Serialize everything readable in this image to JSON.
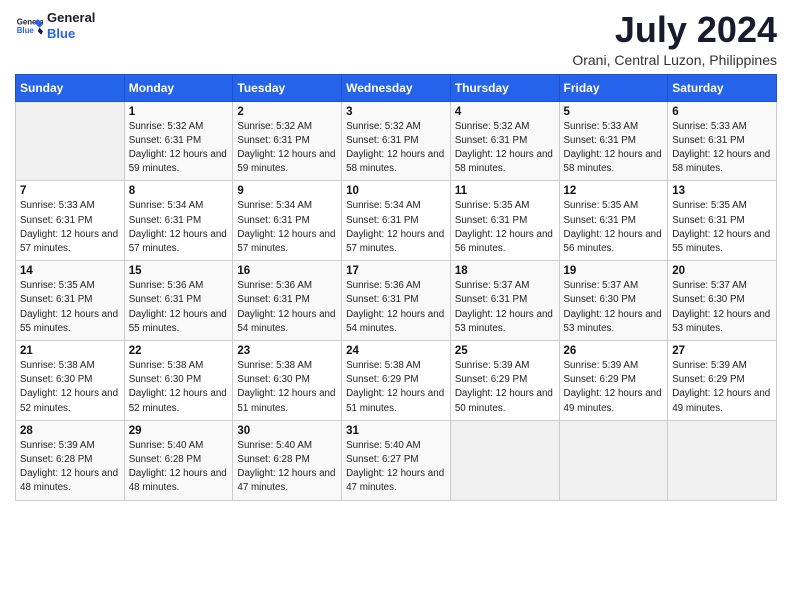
{
  "header": {
    "logo_line1": "General",
    "logo_line2": "Blue",
    "month": "July 2024",
    "location": "Orani, Central Luzon, Philippines"
  },
  "days_of_week": [
    "Sunday",
    "Monday",
    "Tuesday",
    "Wednesday",
    "Thursday",
    "Friday",
    "Saturday"
  ],
  "weeks": [
    [
      {
        "num": "",
        "empty": true
      },
      {
        "num": "1",
        "sunrise": "5:32 AM",
        "sunset": "6:31 PM",
        "daylight": "12 hours and 59 minutes."
      },
      {
        "num": "2",
        "sunrise": "5:32 AM",
        "sunset": "6:31 PM",
        "daylight": "12 hours and 59 minutes."
      },
      {
        "num": "3",
        "sunrise": "5:32 AM",
        "sunset": "6:31 PM",
        "daylight": "12 hours and 58 minutes."
      },
      {
        "num": "4",
        "sunrise": "5:32 AM",
        "sunset": "6:31 PM",
        "daylight": "12 hours and 58 minutes."
      },
      {
        "num": "5",
        "sunrise": "5:33 AM",
        "sunset": "6:31 PM",
        "daylight": "12 hours and 58 minutes."
      },
      {
        "num": "6",
        "sunrise": "5:33 AM",
        "sunset": "6:31 PM",
        "daylight": "12 hours and 58 minutes."
      }
    ],
    [
      {
        "num": "7",
        "sunrise": "5:33 AM",
        "sunset": "6:31 PM",
        "daylight": "12 hours and 57 minutes."
      },
      {
        "num": "8",
        "sunrise": "5:34 AM",
        "sunset": "6:31 PM",
        "daylight": "12 hours and 57 minutes."
      },
      {
        "num": "9",
        "sunrise": "5:34 AM",
        "sunset": "6:31 PM",
        "daylight": "12 hours and 57 minutes."
      },
      {
        "num": "10",
        "sunrise": "5:34 AM",
        "sunset": "6:31 PM",
        "daylight": "12 hours and 57 minutes."
      },
      {
        "num": "11",
        "sunrise": "5:35 AM",
        "sunset": "6:31 PM",
        "daylight": "12 hours and 56 minutes."
      },
      {
        "num": "12",
        "sunrise": "5:35 AM",
        "sunset": "6:31 PM",
        "daylight": "12 hours and 56 minutes."
      },
      {
        "num": "13",
        "sunrise": "5:35 AM",
        "sunset": "6:31 PM",
        "daylight": "12 hours and 55 minutes."
      }
    ],
    [
      {
        "num": "14",
        "sunrise": "5:35 AM",
        "sunset": "6:31 PM",
        "daylight": "12 hours and 55 minutes."
      },
      {
        "num": "15",
        "sunrise": "5:36 AM",
        "sunset": "6:31 PM",
        "daylight": "12 hours and 55 minutes."
      },
      {
        "num": "16",
        "sunrise": "5:36 AM",
        "sunset": "6:31 PM",
        "daylight": "12 hours and 54 minutes."
      },
      {
        "num": "17",
        "sunrise": "5:36 AM",
        "sunset": "6:31 PM",
        "daylight": "12 hours and 54 minutes."
      },
      {
        "num": "18",
        "sunrise": "5:37 AM",
        "sunset": "6:31 PM",
        "daylight": "12 hours and 53 minutes."
      },
      {
        "num": "19",
        "sunrise": "5:37 AM",
        "sunset": "6:30 PM",
        "daylight": "12 hours and 53 minutes."
      },
      {
        "num": "20",
        "sunrise": "5:37 AM",
        "sunset": "6:30 PM",
        "daylight": "12 hours and 53 minutes."
      }
    ],
    [
      {
        "num": "21",
        "sunrise": "5:38 AM",
        "sunset": "6:30 PM",
        "daylight": "12 hours and 52 minutes."
      },
      {
        "num": "22",
        "sunrise": "5:38 AM",
        "sunset": "6:30 PM",
        "daylight": "12 hours and 52 minutes."
      },
      {
        "num": "23",
        "sunrise": "5:38 AM",
        "sunset": "6:30 PM",
        "daylight": "12 hours and 51 minutes."
      },
      {
        "num": "24",
        "sunrise": "5:38 AM",
        "sunset": "6:29 PM",
        "daylight": "12 hours and 51 minutes."
      },
      {
        "num": "25",
        "sunrise": "5:39 AM",
        "sunset": "6:29 PM",
        "daylight": "12 hours and 50 minutes."
      },
      {
        "num": "26",
        "sunrise": "5:39 AM",
        "sunset": "6:29 PM",
        "daylight": "12 hours and 49 minutes."
      },
      {
        "num": "27",
        "sunrise": "5:39 AM",
        "sunset": "6:29 PM",
        "daylight": "12 hours and 49 minutes."
      }
    ],
    [
      {
        "num": "28",
        "sunrise": "5:39 AM",
        "sunset": "6:28 PM",
        "daylight": "12 hours and 48 minutes."
      },
      {
        "num": "29",
        "sunrise": "5:40 AM",
        "sunset": "6:28 PM",
        "daylight": "12 hours and 48 minutes."
      },
      {
        "num": "30",
        "sunrise": "5:40 AM",
        "sunset": "6:28 PM",
        "daylight": "12 hours and 47 minutes."
      },
      {
        "num": "31",
        "sunrise": "5:40 AM",
        "sunset": "6:27 PM",
        "daylight": "12 hours and 47 minutes."
      },
      {
        "num": "",
        "empty": true
      },
      {
        "num": "",
        "empty": true
      },
      {
        "num": "",
        "empty": true
      }
    ]
  ]
}
